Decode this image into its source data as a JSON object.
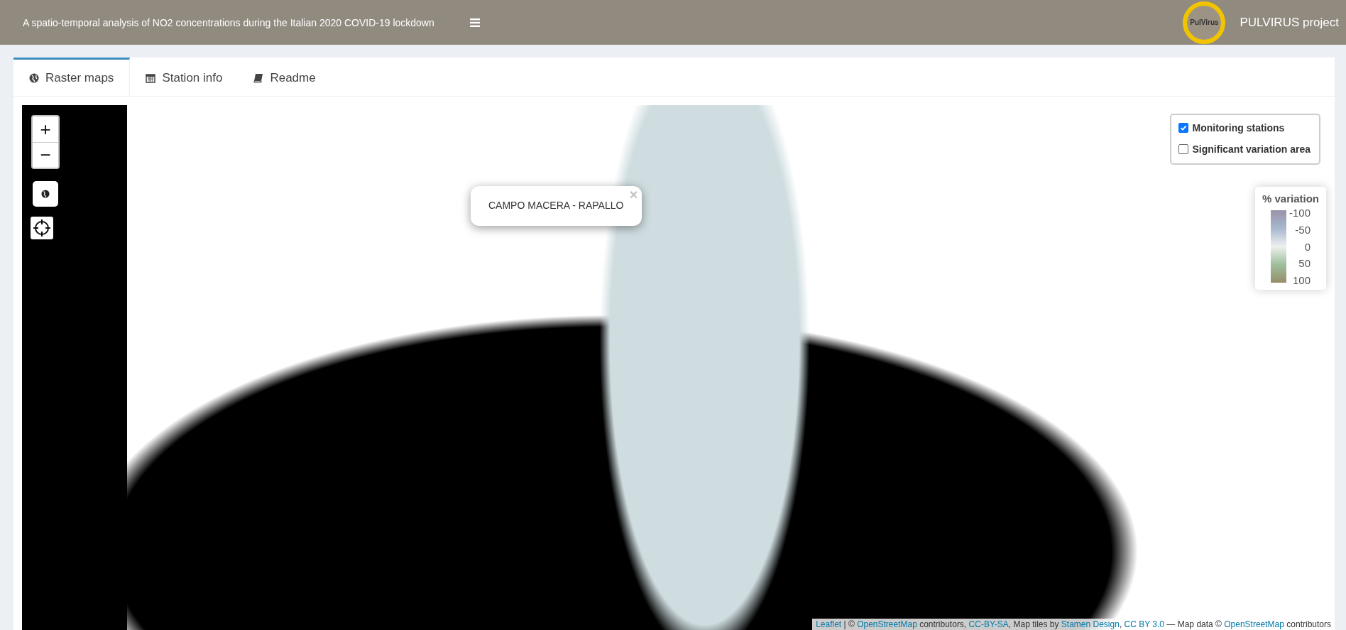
{
  "header": {
    "title": "A spatio-temporal analysis of NO2 concentrations during the Italian 2020 COVID-19 lockdown",
    "logo_text": "PulVirus",
    "project": "PULVIRUS project"
  },
  "tabs": [
    {
      "label": "Raster maps",
      "kind": "globe",
      "selected": true
    },
    {
      "label": "Station info",
      "kind": "calendar",
      "selected": false
    },
    {
      "label": "Readme",
      "kind": "book",
      "selected": false
    }
  ],
  "map": {
    "zoom_in": "+",
    "zoom_out": "−",
    "popup": {
      "text": "CAMPO MACERA - RAPALLO",
      "close": "×"
    },
    "layers": [
      {
        "label": "Monitoring stations",
        "checked": true
      },
      {
        "label": "Significant variation area",
        "checked": false
      }
    ],
    "legend": {
      "title": "% variation",
      "ticks": [
        "-100",
        "-50",
        "0",
        "50",
        "100"
      ]
    },
    "attribution": [
      {
        "kind": "link",
        "text": "Leaflet"
      },
      {
        "kind": "text",
        "text": " | © "
      },
      {
        "kind": "link",
        "text": "OpenStreetMap"
      },
      {
        "kind": "text",
        "text": " contributors, "
      },
      {
        "kind": "link",
        "text": "CC-BY-SA"
      },
      {
        "kind": "text",
        "text": ", Map tiles by "
      },
      {
        "kind": "link",
        "text": "Stamen Design"
      },
      {
        "kind": "text",
        "text": ", "
      },
      {
        "kind": "link",
        "text": "CC BY 3.0"
      },
      {
        "kind": "text",
        "text": " — Map data © "
      },
      {
        "kind": "link",
        "text": "OpenStreetMap"
      },
      {
        "kind": "text",
        "text": " contributors"
      }
    ]
  }
}
